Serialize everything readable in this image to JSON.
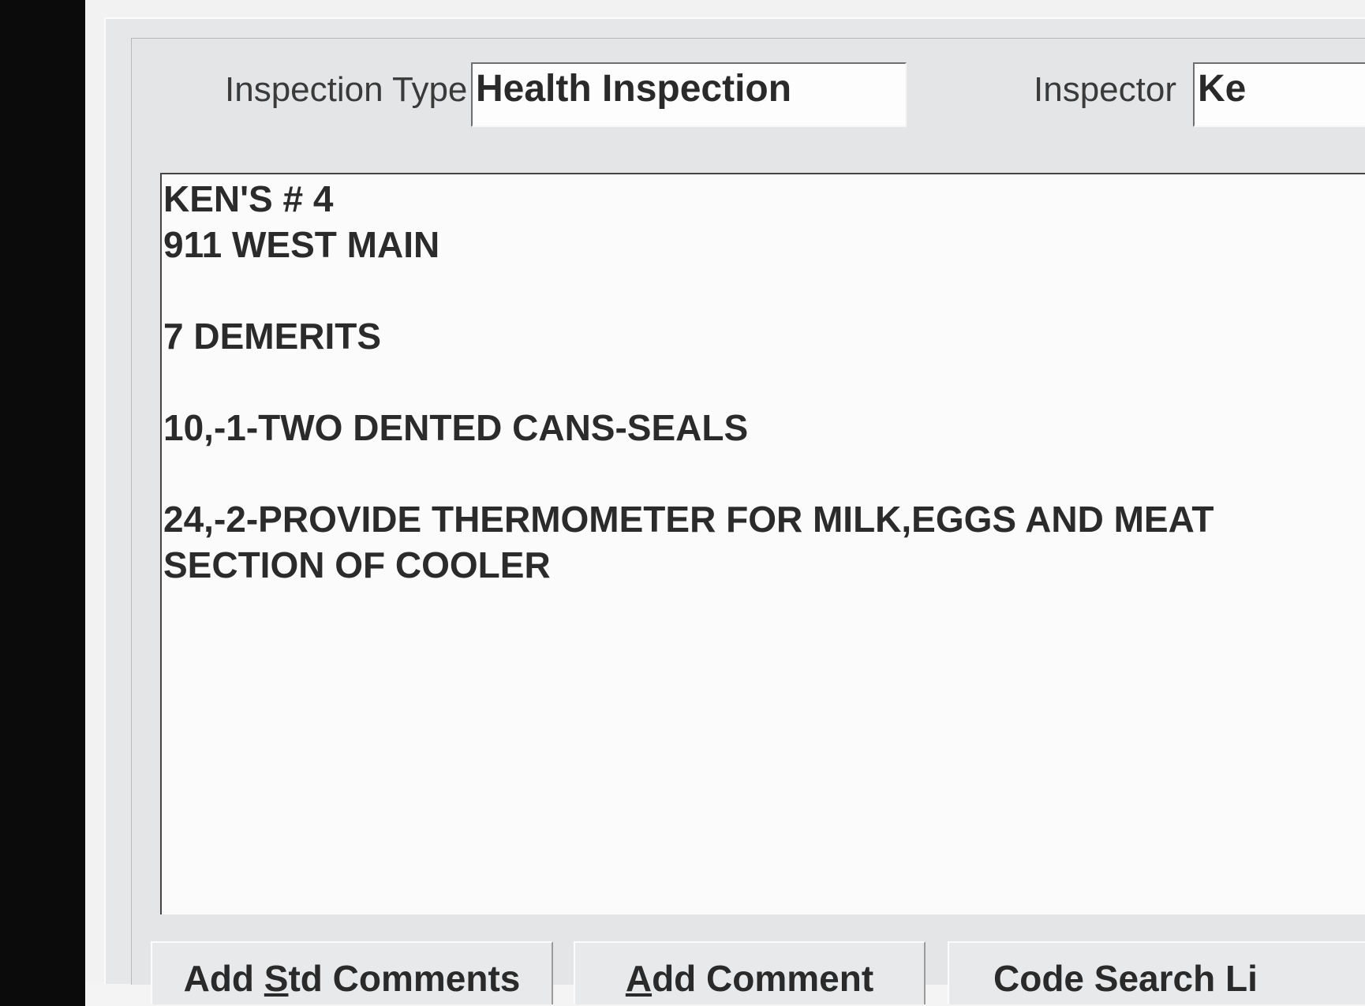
{
  "form": {
    "inspection_type_label": "Inspection Type",
    "inspection_type_value": "Health Inspection",
    "inspector_label": "Inspector",
    "inspector_value": "Ke"
  },
  "comments": {
    "lines": [
      "KEN'S # 4",
      "911 WEST MAIN",
      "",
      "7 DEMERITS",
      "",
      "10,-1-TWO DENTED CANS-SEALS",
      "",
      "24,-2-PROVIDE THERMOMETER FOR MILK,EGGS AND MEAT",
      "SECTION OF COOLER"
    ]
  },
  "buttons": {
    "add_std_comments": {
      "pre": "Add ",
      "accel": "S",
      "post": "td Comments"
    },
    "add_comment": {
      "pre": "",
      "accel": "A",
      "post": "dd Comment"
    },
    "code_search": {
      "label": "Code Search Li"
    }
  }
}
